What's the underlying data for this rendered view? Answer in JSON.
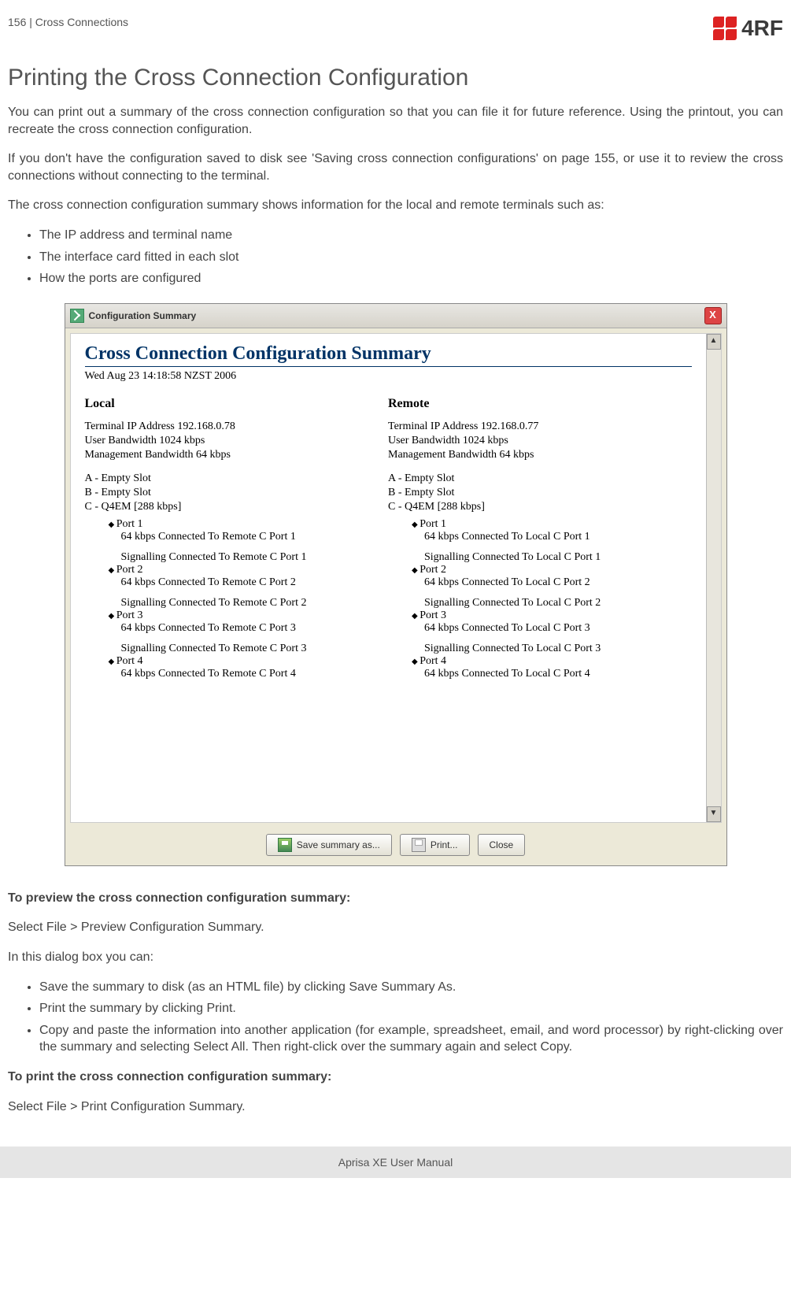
{
  "header": {
    "page_ref": "156  |  Cross Connections",
    "brand": "4RF"
  },
  "title": "Printing the Cross Connection Configuration",
  "paragraphs": {
    "p1": "You can print out a summary of the cross connection configuration so that you can file it for future reference. Using the printout, you can recreate the cross connection configuration.",
    "p2": "If you don't have the configuration saved to disk see 'Saving cross connection configurations' on page 155, or use it to review the cross connections without connecting to the terminal.",
    "p3": "The cross connection configuration summary shows information for the local and remote terminals such as:"
  },
  "list1": [
    "The IP address and terminal name",
    "The interface card fitted in each slot",
    "How the ports are configured"
  ],
  "dialog": {
    "title": "Configuration Summary",
    "close": "X",
    "heading": "Cross Connection Configuration Summary",
    "timestamp": "Wed Aug 23 14:18:58 NZST 2006",
    "local": {
      "label": "Local",
      "ip": "Terminal IP Address 192.168.0.78",
      "userbw": "User Bandwidth 1024 kbps",
      "mgmtbw": "Management Bandwidth 64 kbps",
      "slotA": "A - Empty Slot",
      "slotB": "B - Empty Slot",
      "slotC": "C - Q4EM [288 kbps]",
      "ports": [
        {
          "name": "Port 1",
          "conn": "64 kbps Connected To Remote C Port 1",
          "sig": "Signalling Connected To Remote C Port 1"
        },
        {
          "name": "Port 2",
          "conn": "64 kbps Connected To Remote C Port 2",
          "sig": "Signalling Connected To Remote C Port 2"
        },
        {
          "name": "Port 3",
          "conn": "64 kbps Connected To Remote C Port 3",
          "sig": "Signalling Connected To Remote C Port 3"
        },
        {
          "name": "Port 4",
          "conn": "64 kbps Connected To Remote C Port 4",
          "sig": ""
        }
      ]
    },
    "remote": {
      "label": "Remote",
      "ip": "Terminal IP Address 192.168.0.77",
      "userbw": "User Bandwidth 1024 kbps",
      "mgmtbw": "Management Bandwidth 64 kbps",
      "slotA": "A - Empty Slot",
      "slotB": "B - Empty Slot",
      "slotC": "C - Q4EM [288 kbps]",
      "ports": [
        {
          "name": "Port 1",
          "conn": "64 kbps Connected To Local C Port 1",
          "sig": "Signalling Connected To Local C Port 1"
        },
        {
          "name": "Port 2",
          "conn": "64 kbps Connected To Local C Port 2",
          "sig": "Signalling Connected To Local C Port 2"
        },
        {
          "name": "Port 3",
          "conn": "64 kbps Connected To Local C Port 3",
          "sig": "Signalling Connected To Local C Port 3"
        },
        {
          "name": "Port 4",
          "conn": "64 kbps Connected To Local C Port 4",
          "sig": ""
        }
      ]
    },
    "buttons": {
      "save": "Save summary as...",
      "print": "Print...",
      "close": "Close"
    },
    "scroll_up": "▲",
    "scroll_down": "▼"
  },
  "section2": {
    "h_preview": "To preview the cross connection configuration summary:",
    "p_preview": "Select File > Preview Configuration Summary.",
    "p_inthis": "In this dialog box you can:",
    "list2": [
      "Save the summary to disk (as an HTML file) by clicking Save Summary As.",
      "Print the summary by clicking Print.",
      "Copy and paste the information into another application (for example, spreadsheet, email, and word processor) by right-clicking over the summary and selecting Select All. Then right-click over the summary again and select Copy."
    ],
    "h_print": "To print the cross connection configuration summary:",
    "p_print": "Select File > Print Configuration Summary."
  },
  "footer": "Aprisa XE User Manual"
}
